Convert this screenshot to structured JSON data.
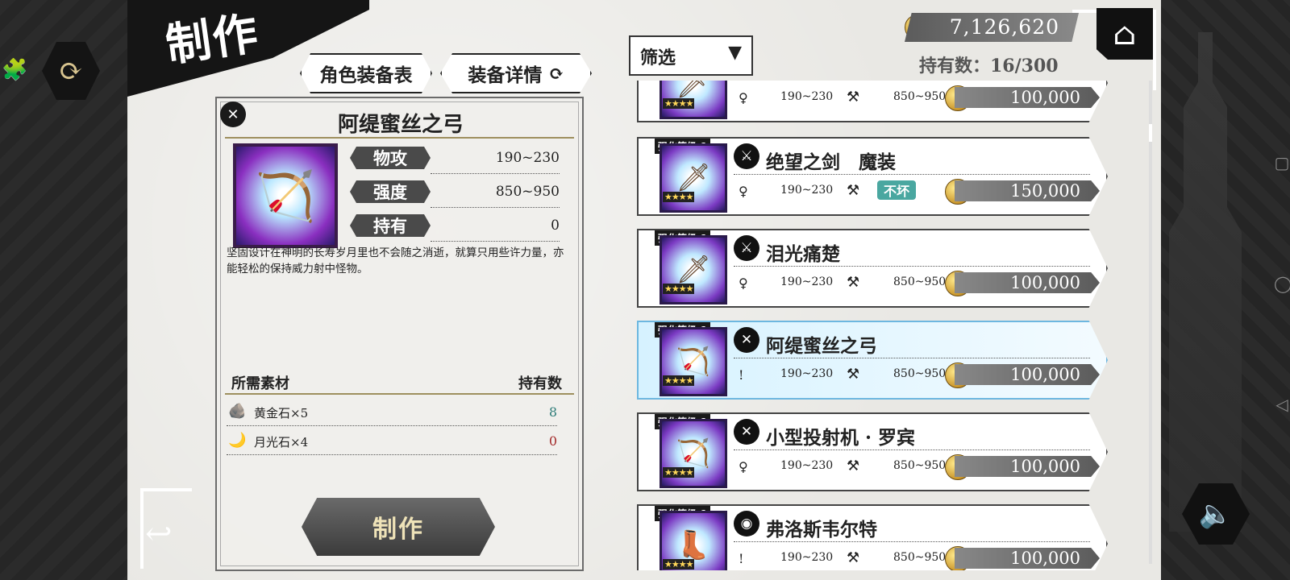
{
  "header": {
    "title": "制作"
  },
  "tabs": {
    "character_equipment": "角色装备表",
    "equipment_details": "装备详情"
  },
  "top_right": {
    "currency": "7,126,620",
    "owned": "持有数：16/300"
  },
  "filter": {
    "label": "筛选"
  },
  "detail": {
    "item_name": "阿缇蜜丝之弓",
    "stats": [
      {
        "label": "物攻",
        "value": "190~230"
      },
      {
        "label": "强度",
        "value": "850~950"
      },
      {
        "label": "持有",
        "value": "0"
      }
    ],
    "description": "坚固设计在神明的长寿岁月里也不会随之消逝，就算只用些许力量，亦能轻松的保持威力射中怪物。",
    "materials_header": "所需素材",
    "owned_header": "持有数",
    "materials": [
      {
        "name": "黄金石×5",
        "owned": "8",
        "color": "#2d7c78"
      },
      {
        "name": "月光石×4",
        "owned": "0",
        "color": "#a32a2a"
      }
    ],
    "craft_button": "制作"
  },
  "list": {
    "items": [
      {
        "badge": "",
        "name": "",
        "atk": "190~230",
        "dur": "850~950",
        "price": "100,000",
        "dur_badge": "",
        "icon": "sword",
        "selected": false
      },
      {
        "badge": "强化等级-1",
        "name": "绝望之剑　魔装",
        "atk": "190~230",
        "dur": "",
        "price": "150,000",
        "dur_badge": "不坏",
        "icon": "sword",
        "selected": false
      },
      {
        "badge": "强化等级-1",
        "name": "泪光痛楚",
        "atk": "190~230",
        "dur": "850~950",
        "price": "100,000",
        "dur_badge": "",
        "icon": "sword",
        "selected": false
      },
      {
        "badge": "强化等级-1",
        "name": "阿缇蜜丝之弓",
        "atk": "190~230",
        "dur": "850~950",
        "price": "100,000",
        "dur_badge": "",
        "icon": "bow",
        "selected": true
      },
      {
        "badge": "强化等级-1",
        "name": "小型投射机 · 罗宾",
        "atk": "190~230",
        "dur": "850~950",
        "price": "100,000",
        "dur_badge": "",
        "icon": "bow",
        "selected": false
      },
      {
        "badge": "强化等级-1",
        "name": "弗洛斯韦尔特",
        "atk": "190~230",
        "dur": "850~950",
        "price": "100,000",
        "dur_badge": "",
        "icon": "boot",
        "selected": false
      }
    ]
  },
  "colors": {
    "accent_gold": "#d8c48f",
    "selected_row": "#d6f2ff"
  }
}
